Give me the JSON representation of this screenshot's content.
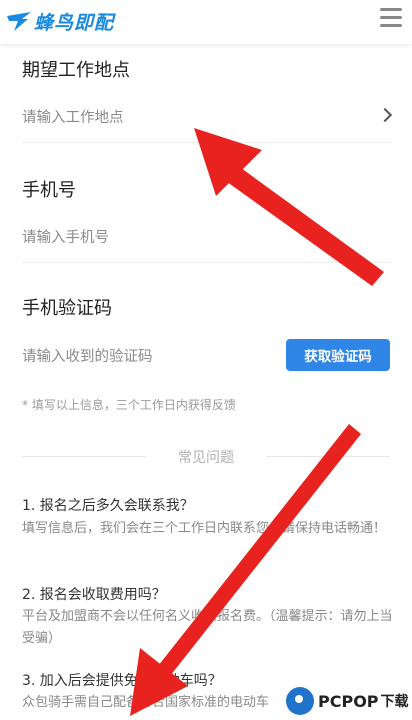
{
  "header": {
    "logo_text": "蜂鸟即配",
    "logo_icon": "bird-logo-icon",
    "menu_icon": "hamburger-menu-icon"
  },
  "form": {
    "location_title": "期望工作地点",
    "location_placeholder": "请输入工作地点",
    "phone_title": "手机号",
    "phone_placeholder": "请输入手机号",
    "code_title": "手机验证码",
    "code_placeholder": "请输入收到的验证码",
    "code_button": "获取验证码",
    "hint": "* 填写以上信息，三个工作日内获得反馈"
  },
  "faq": {
    "heading": "常见问题",
    "items": [
      {
        "q": "1. 报名之后多久会联系我？",
        "a": "填写信息后，我们会在三个工作日内联系您，请保持电话畅通！"
      },
      {
        "q": "2. 报名会收取费用吗？",
        "a": "平台及加盟商不会以任何名义收取报名费。（温馨提示：请勿上当受骗）"
      },
      {
        "q": "3. 加入后会提供免费电动车吗？",
        "a": "众包骑手需自己配备符合国家标准的电动车"
      }
    ]
  },
  "watermark": {
    "brand": "PCPOP",
    "suffix": "下载"
  },
  "colors": {
    "accent": "#2f86e6",
    "arrow": "#e8231f"
  }
}
